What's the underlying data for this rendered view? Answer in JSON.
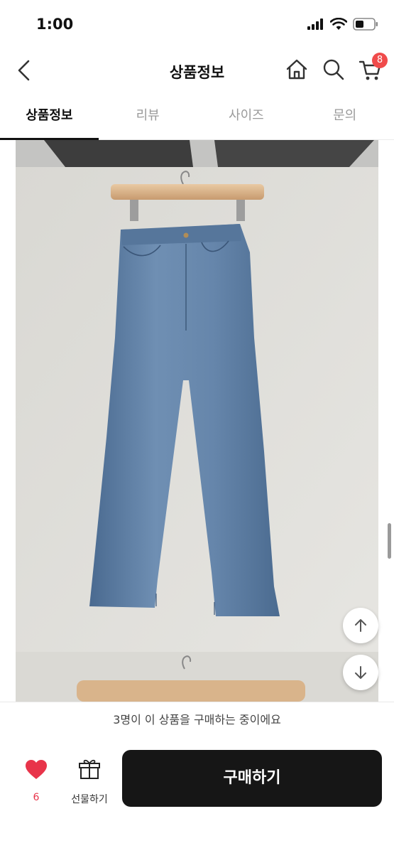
{
  "status_bar": {
    "time": "1:00"
  },
  "header": {
    "title": "상품정보",
    "cart_count": "8"
  },
  "tabs": [
    {
      "label": "상품정보",
      "active": true
    },
    {
      "label": "리뷰",
      "active": false
    },
    {
      "label": "사이즈",
      "active": false
    },
    {
      "label": "문의",
      "active": false
    }
  ],
  "notice": {
    "text": "3명이 이 상품을 구매하는 중이에요"
  },
  "bottom": {
    "like_count": "6",
    "gift_label": "선물하기",
    "buy_label": "구매하기"
  },
  "colors": {
    "accent": "#f04b4b",
    "like": "#e8344a",
    "buy_button": "#161616",
    "denim": "#5d7ea3"
  }
}
